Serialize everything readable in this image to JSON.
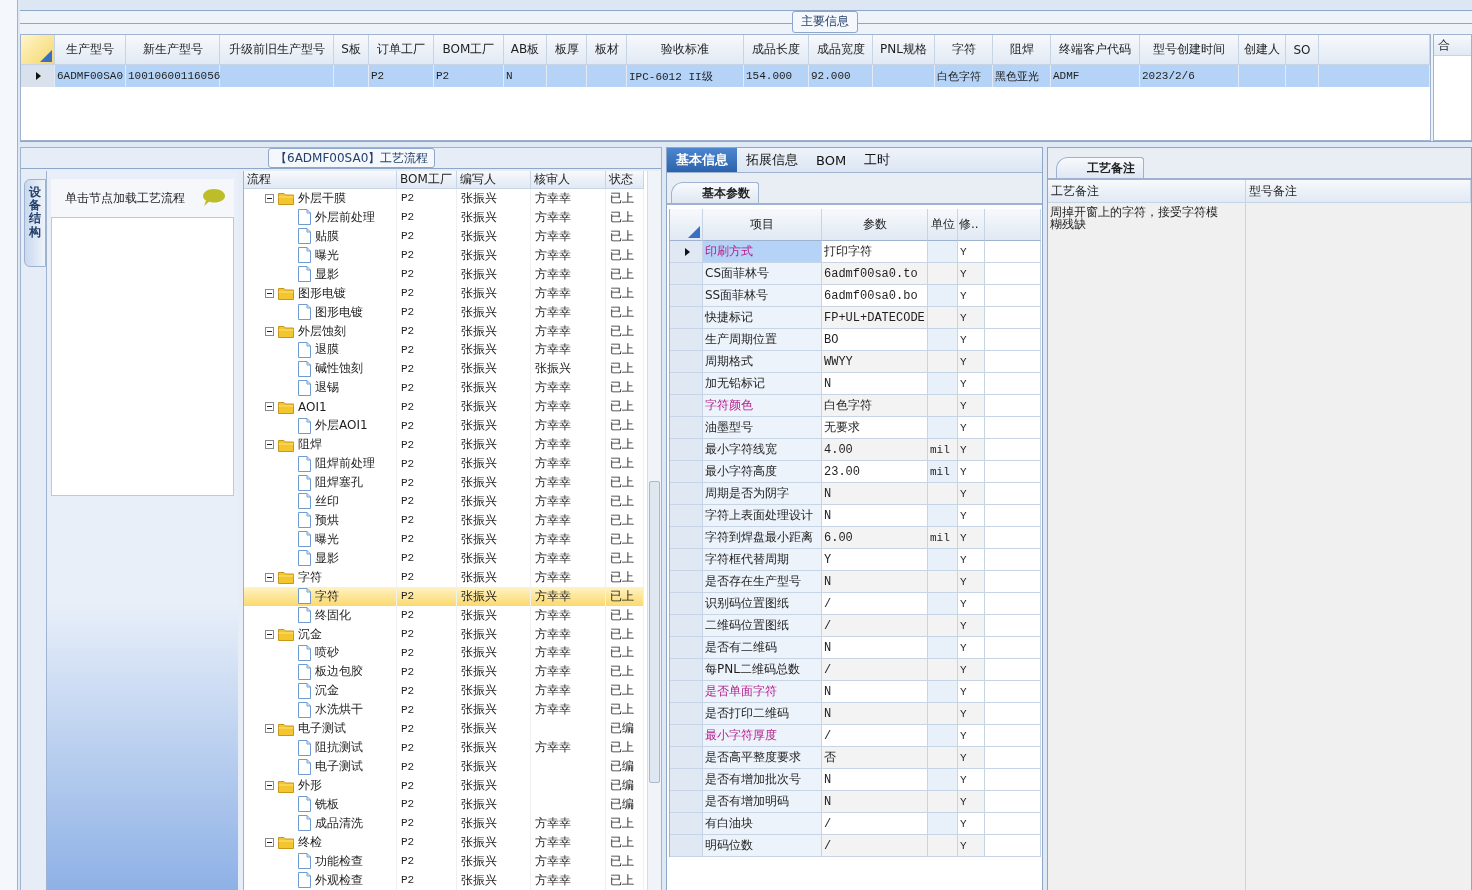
{
  "main_info": {
    "title": "主要信息",
    "side_header": "合",
    "table": {
      "columns": [
        "生产型号",
        "新生产型号",
        "升级前旧生产型号",
        "S板",
        "订单工厂",
        "BOM工厂",
        "AB板",
        "板厚",
        "板材",
        "验收标准",
        "成品长度",
        "成品宽度",
        "PNL规格",
        "字符",
        "阻焊",
        "终端客户代码",
        "型号创建时间",
        "创建人",
        "SO"
      ],
      "rows": [
        {
          "selected": true,
          "cells": [
            "6ADMF00SA0",
            "10010600116056",
            null,
            null,
            "P2",
            "P2",
            "N",
            null,
            null,
            "IPC-6012 II级",
            "154.000",
            "92.000",
            null,
            "白色字符",
            "黑色亚光",
            "ADMF",
            "2023/2/6",
            null,
            null
          ]
        }
      ]
    }
  },
  "process": {
    "title": "【6ADMF00SA0】工艺流程",
    "side_tab": "设备结构",
    "hint": "单击节点加载工艺流程",
    "columns": [
      "流程",
      "BOM工厂",
      "编写人",
      "核审人",
      "状态"
    ],
    "tree": [
      {
        "name": "外层干膜",
        "bom": "P2",
        "writer": "张振兴",
        "reviewer": "方幸幸",
        "status": "已上",
        "selected": false,
        "expanded": true,
        "children": [
          {
            "name": "外层前处理",
            "bom": "P2",
            "writer": "张振兴",
            "reviewer": "方幸幸",
            "status": "已上",
            "selected": false
          },
          {
            "name": "贴膜",
            "bom": "P2",
            "writer": "张振兴",
            "reviewer": "方幸幸",
            "status": "已上",
            "selected": false
          },
          {
            "name": "曝光",
            "bom": "P2",
            "writer": "张振兴",
            "reviewer": "方幸幸",
            "status": "已上",
            "selected": false
          },
          {
            "name": "显影",
            "bom": "P2",
            "writer": "张振兴",
            "reviewer": "方幸幸",
            "status": "已上",
            "selected": false
          }
        ]
      },
      {
        "name": "图形电镀",
        "bom": "P2",
        "writer": "张振兴",
        "reviewer": "方幸幸",
        "status": "已上",
        "selected": false,
        "expanded": true,
        "children": [
          {
            "name": "图形电镀",
            "bom": "P2",
            "writer": "张振兴",
            "reviewer": "方幸幸",
            "status": "已上",
            "selected": false
          }
        ]
      },
      {
        "name": "外层蚀刻",
        "bom": "P2",
        "writer": "张振兴",
        "reviewer": "方幸幸",
        "status": "已上",
        "selected": false,
        "expanded": true,
        "children": [
          {
            "name": "退膜",
            "bom": "P2",
            "writer": "张振兴",
            "reviewer": "方幸幸",
            "status": "已上",
            "selected": false
          },
          {
            "name": "碱性蚀刻",
            "bom": "P2",
            "writer": "张振兴",
            "reviewer": "张振兴",
            "status": "已上",
            "selected": false
          },
          {
            "name": "退锡",
            "bom": "P2",
            "writer": "张振兴",
            "reviewer": "方幸幸",
            "status": "已上",
            "selected": false
          }
        ]
      },
      {
        "name": "AOI1",
        "bom": "P2",
        "writer": "张振兴",
        "reviewer": "方幸幸",
        "status": "已上",
        "selected": false,
        "expanded": true,
        "children": [
          {
            "name": "外层AOI1",
            "bom": "P2",
            "writer": "张振兴",
            "reviewer": "方幸幸",
            "status": "已上",
            "selected": false
          }
        ]
      },
      {
        "name": "阻焊",
        "bom": "P2",
        "writer": "张振兴",
        "reviewer": "方幸幸",
        "status": "已上",
        "selected": false,
        "expanded": true,
        "children": [
          {
            "name": "阻焊前处理",
            "bom": "P2",
            "writer": "张振兴",
            "reviewer": "方幸幸",
            "status": "已上",
            "selected": false
          },
          {
            "name": "阻焊塞孔",
            "bom": "P2",
            "writer": "张振兴",
            "reviewer": "方幸幸",
            "status": "已上",
            "selected": false
          },
          {
            "name": "丝印",
            "bom": "P2",
            "writer": "张振兴",
            "reviewer": "方幸幸",
            "status": "已上",
            "selected": false
          },
          {
            "name": "预烘",
            "bom": "P2",
            "writer": "张振兴",
            "reviewer": "方幸幸",
            "status": "已上",
            "selected": false
          },
          {
            "name": "曝光",
            "bom": "P2",
            "writer": "张振兴",
            "reviewer": "方幸幸",
            "status": "已上",
            "selected": false
          },
          {
            "name": "显影",
            "bom": "P2",
            "writer": "张振兴",
            "reviewer": "方幸幸",
            "status": "已上",
            "selected": false
          }
        ]
      },
      {
        "name": "字符",
        "bom": "P2",
        "writer": "张振兴",
        "reviewer": "方幸幸",
        "status": "已上",
        "selected": false,
        "expanded": true,
        "children": [
          {
            "name": "字符",
            "bom": "P2",
            "writer": "张振兴",
            "reviewer": "方幸幸",
            "status": "已上",
            "selected": true
          },
          {
            "name": "终固化",
            "bom": "P2",
            "writer": "张振兴",
            "reviewer": "方幸幸",
            "status": "已上",
            "selected": false
          }
        ]
      },
      {
        "name": "沉金",
        "bom": "P2",
        "writer": "张振兴",
        "reviewer": "方幸幸",
        "status": "已上",
        "selected": false,
        "expanded": true,
        "children": [
          {
            "name": "喷砂",
            "bom": "P2",
            "writer": "张振兴",
            "reviewer": "方幸幸",
            "status": "已上",
            "selected": false
          },
          {
            "name": "板边包胶",
            "bom": "P2",
            "writer": "张振兴",
            "reviewer": "方幸幸",
            "status": "已上",
            "selected": false
          },
          {
            "name": "沉金",
            "bom": "P2",
            "writer": "张振兴",
            "reviewer": "方幸幸",
            "status": "已上",
            "selected": false
          },
          {
            "name": "水洗烘干",
            "bom": "P2",
            "writer": "张振兴",
            "reviewer": "方幸幸",
            "status": "已上",
            "selected": false
          }
        ]
      },
      {
        "name": "电子测试",
        "bom": "P2",
        "writer": "张振兴",
        "status": "已编",
        "selected": false,
        "expanded": true,
        "children": [
          {
            "name": "阻抗测试",
            "bom": "P2",
            "writer": "张振兴",
            "reviewer": "方幸幸",
            "status": "已上",
            "selected": false
          },
          {
            "name": "电子测试",
            "bom": "P2",
            "writer": "张振兴",
            "status": "已编",
            "selected": false
          }
        ]
      },
      {
        "name": "外形",
        "bom": "P2",
        "writer": "张振兴",
        "status": "已编",
        "selected": false,
        "expanded": true,
        "children": [
          {
            "name": "铣板",
            "bom": "P2",
            "writer": "张振兴",
            "status": "已编",
            "selected": false
          },
          {
            "name": "成品清洗",
            "bom": "P2",
            "writer": "张振兴",
            "reviewer": "方幸幸",
            "status": "已上",
            "selected": false
          }
        ]
      },
      {
        "name": "终检",
        "bom": "P2",
        "writer": "张振兴",
        "reviewer": "方幸幸",
        "status": "已上",
        "selected": false,
        "expanded": true,
        "children": [
          {
            "name": "功能检查",
            "bom": "P2",
            "writer": "张振兴",
            "reviewer": "方幸幸",
            "status": "已上",
            "selected": false
          },
          {
            "name": "外观检查",
            "bom": "P2",
            "writer": "张振兴",
            "reviewer": "方幸幸",
            "status": "已上",
            "selected": false
          }
        ]
      }
    ]
  },
  "details": {
    "tabs": [
      {
        "label": "基本信息",
        "selected": true
      },
      {
        "label": "拓展信息",
        "selected": false
      },
      {
        "label": "BOM",
        "selected": false
      },
      {
        "label": "工时",
        "selected": false
      }
    ],
    "subtab": "基本参数",
    "columns": [
      "项目",
      "参数",
      "单位",
      "修.."
    ],
    "rows": [
      {
        "item": "印刷方式",
        "value": "打印字符",
        "unit": null,
        "flag": "Y",
        "highlighted": true,
        "selected": true
      },
      {
        "item": "CS面菲林号",
        "value": "6admf00sa0.to",
        "unit": null,
        "flag": "Y",
        "highlighted": false,
        "selected": false
      },
      {
        "item": "SS面菲林号",
        "value": "6admf00sa0.bo",
        "unit": null,
        "flag": "Y",
        "highlighted": false,
        "selected": false
      },
      {
        "item": "快捷标记",
        "value": "FP+UL+DATECODE",
        "unit": null,
        "flag": "Y",
        "highlighted": false,
        "selected": false
      },
      {
        "item": "生产周期位置",
        "value": "BO",
        "unit": null,
        "flag": "Y",
        "highlighted": false,
        "selected": false
      },
      {
        "item": "周期格式",
        "value": "WWYY",
        "unit": null,
        "flag": "Y",
        "highlighted": false,
        "selected": false
      },
      {
        "item": "加无铅标记",
        "value": "N",
        "unit": null,
        "flag": "Y",
        "highlighted": false,
        "selected": false
      },
      {
        "item": "字符颜色",
        "value": "白色字符",
        "unit": null,
        "flag": "Y",
        "highlighted": true,
        "selected": false
      },
      {
        "item": "油墨型号",
        "value": "无要求",
        "unit": null,
        "flag": "Y",
        "highlighted": false,
        "selected": false
      },
      {
        "item": "最小字符线宽",
        "value": "4.00",
        "unit": "mil",
        "flag": "Y",
        "highlighted": false,
        "selected": false
      },
      {
        "item": "最小字符高度",
        "value": "23.00",
        "unit": "mil",
        "flag": "Y",
        "highlighted": false,
        "selected": false
      },
      {
        "item": "周期是否为阴字",
        "value": "N",
        "unit": null,
        "flag": "Y",
        "highlighted": false,
        "selected": false
      },
      {
        "item": "字符上表面处理设计",
        "value": "N",
        "unit": null,
        "flag": "Y",
        "highlighted": false,
        "selected": false
      },
      {
        "item": "字符到焊盘最小距离",
        "value": "6.00",
        "unit": "mil",
        "flag": "Y",
        "highlighted": false,
        "selected": false
      },
      {
        "item": "字符框代替周期",
        "value": "Y",
        "unit": null,
        "flag": "Y",
        "highlighted": false,
        "selected": false
      },
      {
        "item": "是否存在生产型号",
        "value": "N",
        "unit": null,
        "flag": "Y",
        "highlighted": false,
        "selected": false
      },
      {
        "item": "识别码位置图纸",
        "value": "/",
        "unit": null,
        "flag": "Y",
        "highlighted": false,
        "selected": false
      },
      {
        "item": "二维码位置图纸",
        "value": "/",
        "unit": null,
        "flag": "Y",
        "highlighted": false,
        "selected": false
      },
      {
        "item": "是否有二维码",
        "value": "N",
        "unit": null,
        "flag": "Y",
        "highlighted": false,
        "selected": false
      },
      {
        "item": "每PNL二维码总数",
        "value": "/",
        "unit": null,
        "flag": "Y",
        "highlighted": false,
        "selected": false
      },
      {
        "item": "是否单面字符",
        "value": "N",
        "unit": null,
        "flag": "Y",
        "highlighted": true,
        "selected": false
      },
      {
        "item": "是否打印二维码",
        "value": "N",
        "unit": null,
        "flag": "Y",
        "highlighted": false,
        "selected": false
      },
      {
        "item": "最小字符厚度",
        "value": "/",
        "unit": null,
        "flag": "Y",
        "highlighted": true,
        "selected": false
      },
      {
        "item": "是否高平整度要求",
        "value": "否",
        "unit": null,
        "flag": "Y",
        "highlighted": false,
        "selected": false
      },
      {
        "item": "是否有增加批次号",
        "value": "N",
        "unit": null,
        "flag": "Y",
        "highlighted": false,
        "selected": false
      },
      {
        "item": "是否有增加明码",
        "value": "N",
        "unit": null,
        "flag": "Y",
        "highlighted": false,
        "selected": false
      },
      {
        "item": "有白油块",
        "value": "/",
        "unit": null,
        "flag": "Y",
        "highlighted": false,
        "selected": false
      },
      {
        "item": "明码位数",
        "value": "/",
        "unit": null,
        "flag": "Y",
        "highlighted": false,
        "selected": false
      }
    ]
  },
  "notes": {
    "tab": "工艺备注",
    "columns": [
      "工艺备注",
      "型号备注"
    ],
    "process_note": "周掉开窗上的字符，接受字符模糊残缺"
  }
}
